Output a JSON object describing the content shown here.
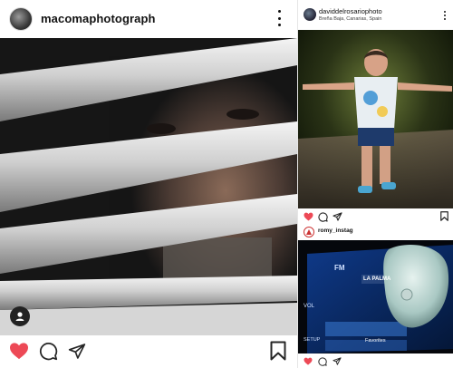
{
  "left_post": {
    "username": "macomaphotograph",
    "liked": true,
    "colors": {
      "like": "#ed4956",
      "icon": "#262626"
    }
  },
  "right_top_post": {
    "username": "daviddelrosariophoto",
    "location": "Breña Baja, Canarias, Spain",
    "liked": true
  },
  "right_bottom_post": {
    "username": "romy_instag",
    "liked": true,
    "screen_labels": {
      "band": "FM",
      "station": "LA PALMA",
      "vol": "VOL",
      "setup": "SETUP",
      "favorites": "Favorites"
    }
  }
}
